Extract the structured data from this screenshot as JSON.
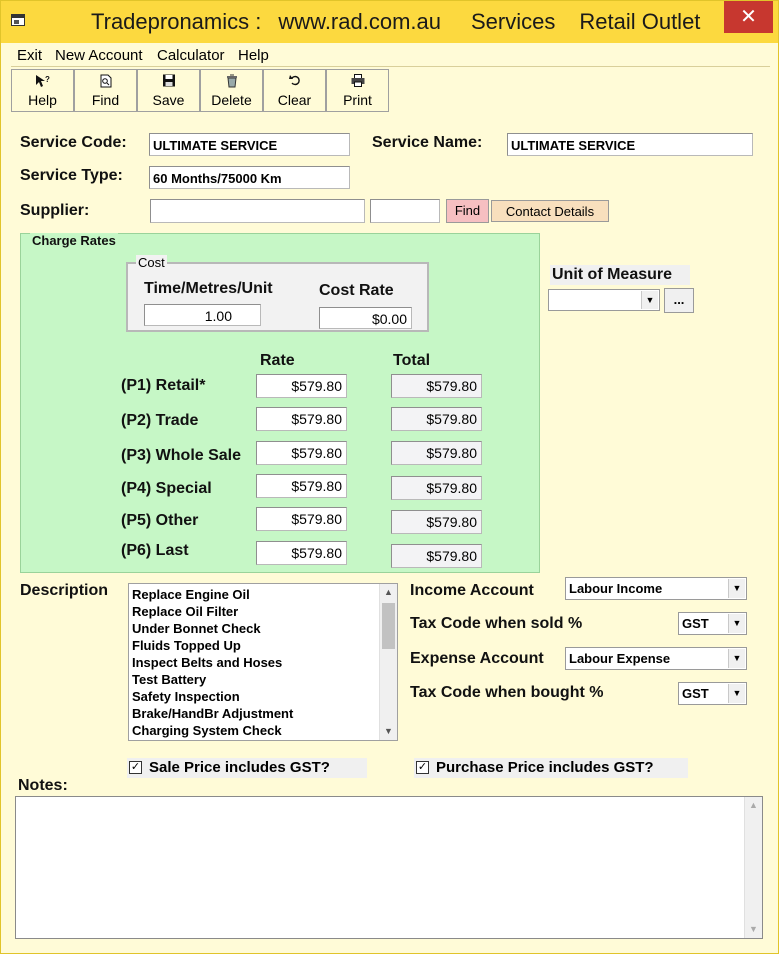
{
  "window": {
    "title_parts": [
      "Tradepronamics :",
      "www.rad.com.au",
      "Services",
      "Retail Outlet"
    ],
    "close_glyph": "✕"
  },
  "menu": {
    "exit": "Exit",
    "new_account": "New Account",
    "calculator": "Calculator",
    "help": "Help"
  },
  "toolbar": {
    "help": "Help",
    "find": "Find",
    "save": "Save",
    "delete": "Delete",
    "clear": "Clear",
    "print": "Print",
    "icons": [
      "help-pointer-icon",
      "find-doc-icon",
      "floppy-disk-icon",
      "delete-bin-icon",
      "undo-arrow-icon",
      "printer-icon"
    ]
  },
  "form": {
    "service_code_label": "Service Code:",
    "service_code_value": "ULTIMATE SERVICE",
    "service_name_label": "Service Name:",
    "service_name_value": "ULTIMATE SERVICE",
    "service_type_label": "Service Type:",
    "service_type_value": "60 Months/75000 Km",
    "supplier_label": "Supplier:",
    "supplier_value": "",
    "supplier_code_value": "",
    "find_button": "Find",
    "contact_details_button": "Contact Details"
  },
  "charge_rates": {
    "legend": "Charge Rates",
    "cost_legend": "Cost",
    "time_label": "Time/Metres/Unit",
    "time_value": "1.00",
    "cost_rate_label": "Cost Rate",
    "cost_rate_value": "$0.00",
    "rate_header": "Rate",
    "total_header": "Total",
    "rows": [
      {
        "label": "(P1) Retail*",
        "rate": "$579.80",
        "total": "$579.80"
      },
      {
        "label": "(P2) Trade",
        "rate": "$579.80",
        "total": "$579.80"
      },
      {
        "label": "(P3) Whole Sale",
        "rate": "$579.80",
        "total": "$579.80"
      },
      {
        "label": "(P4) Special",
        "rate": "$579.80",
        "total": "$579.80"
      },
      {
        "label": "(P5) Other",
        "rate": "$579.80",
        "total": "$579.80"
      },
      {
        "label": "(P6) Last",
        "rate": "$579.80",
        "total": "$579.80"
      }
    ]
  },
  "unit_of_measure": {
    "label": "Unit of Measure",
    "value": "",
    "ellipsis_button": "..."
  },
  "description": {
    "label": "Description",
    "items": [
      "Replace Engine Oil",
      "Replace Oil Filter",
      "Under Bonnet Check",
      "Fluids Topped Up",
      "Inspect Belts and Hoses",
      "Test Battery",
      "Safety Inspection",
      "Brake/HandBr Adjustment",
      "Charging System Check"
    ]
  },
  "accounts": {
    "income_label": "Income Account",
    "income_value": "Labour Income",
    "tax_sold_label": "Tax Code when sold %",
    "tax_sold_value": "GST",
    "expense_label": "Expense Account",
    "expense_value": "Labour Expense",
    "tax_bought_label": "Tax Code when bought %",
    "tax_bought_value": "GST"
  },
  "checkboxes": {
    "sale_gst": "Sale Price includes GST?",
    "sale_gst_checked": true,
    "purchase_gst": "Purchase Price includes GST?",
    "purchase_gst_checked": true
  },
  "notes": {
    "label": "Notes:",
    "value": ""
  }
}
